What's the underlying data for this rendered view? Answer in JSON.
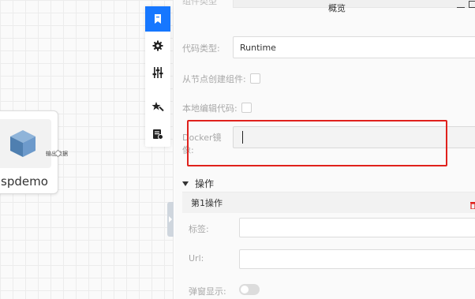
{
  "canvas": {
    "node": {
      "name": "spdemo",
      "port_label": "输出数据",
      "icon": "cube-icon"
    }
  },
  "toolbar": {
    "items": [
      {
        "icon": "bookmark-icon",
        "active": true
      },
      {
        "icon": "gear-icon",
        "active": false
      },
      {
        "icon": "sliders-icon",
        "active": false
      },
      {
        "icon": "magic-wand-icon",
        "active": false
      },
      {
        "icon": "task-list-icon",
        "active": false
      }
    ],
    "accent": "#1677ff"
  },
  "panel": {
    "title": "概览",
    "clipped_label": "组件类型",
    "code_type": {
      "label": "代码类型:",
      "value": "Runtime"
    },
    "create_from_node": {
      "label": "从节点创建组件:"
    },
    "edit_local_code": {
      "label": "本地编辑代码:"
    },
    "docker_image": {
      "label_line1": "Docker镜",
      "label_line2": "像:",
      "value": ""
    },
    "operations_section": {
      "label": "操作"
    },
    "operation_card": {
      "title": "第1操作",
      "tag": {
        "label": "标签:",
        "value": ""
      },
      "url": {
        "label": "Url:",
        "value": ""
      },
      "popup_display": {
        "label": "弹窗显示:"
      }
    }
  },
  "highlight_color": "#e0211c"
}
